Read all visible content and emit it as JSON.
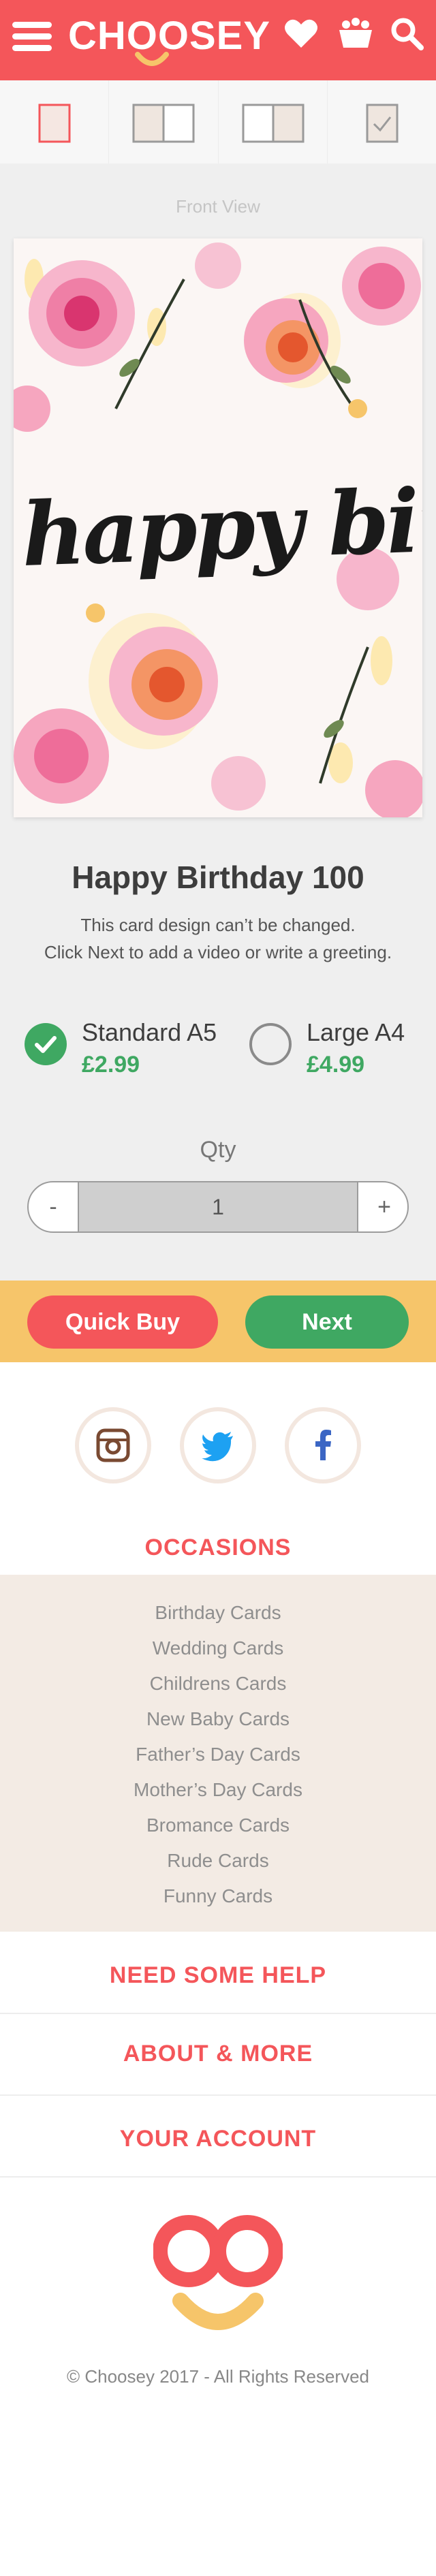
{
  "header": {
    "logo_text": "CHOOSEY",
    "menu_icon": "hamburger-menu-icon",
    "icons": [
      "heart-icon",
      "basket-icon",
      "search-icon"
    ],
    "brand_color": "#f4565a"
  },
  "steps": {
    "items": [
      "front-page-icon",
      "inside-left-icon",
      "inside-right-icon",
      "checkmark-icon"
    ],
    "active_index": 0
  },
  "preview": {
    "view_label": "Front View",
    "card_text": "happy birthday"
  },
  "product": {
    "title": "Happy Birthday 100",
    "note_line1": "This card design can’t be changed.",
    "note_line2": "Click Next to add a video or write a greeting.",
    "sizes": [
      {
        "name": "Standard A5",
        "price": "£2.99",
        "selected": true
      },
      {
        "name": "Large A4",
        "price": "£4.99",
        "selected": false
      }
    ],
    "qty_label": "Qty",
    "qty_minus": "-",
    "qty_value": "1",
    "qty_plus": "+"
  },
  "actions": {
    "quick_buy": "Quick Buy",
    "next": "Next"
  },
  "social": [
    "instagram-icon",
    "twitter-icon",
    "facebook-icon"
  ],
  "occasions": {
    "heading": "OCCASIONS",
    "items": [
      "Birthday Cards",
      "Wedding Cards",
      "Childrens Cards",
      "New Baby Cards",
      "Father’s Day Cards",
      "Mother’s Day Cards",
      "Bromance Cards",
      "Rude Cards",
      "Funny Cards"
    ]
  },
  "footer": {
    "help": "NEED SOME HELP",
    "about": "ABOUT & MORE",
    "account": "YOUR ACCOUNT",
    "copyright": "© Choosey 2017 - All Rights Reserved"
  },
  "colors": {
    "accent_red": "#f4565a",
    "green": "#3fa862",
    "yellow_bar": "#f6c56a"
  }
}
